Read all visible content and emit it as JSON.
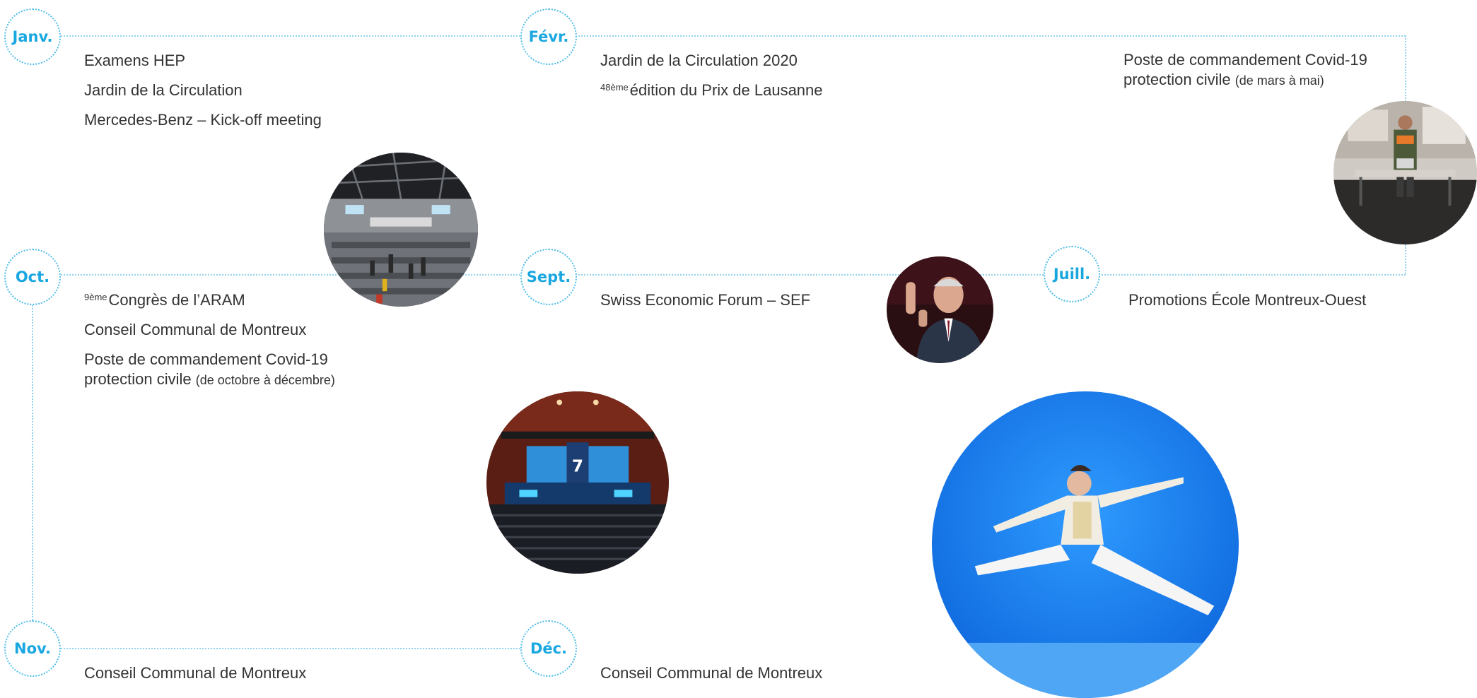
{
  "months": {
    "jan": "Janv.",
    "feb": "Févr.",
    "oct": "Oct.",
    "sep": "Sept.",
    "jul": "Juill.",
    "nov": "Nov.",
    "dec": "Déc."
  },
  "events": {
    "jan1": "Examens HEP",
    "jan2": "Jardin de la Circulation",
    "jan3": "Mercedes-Benz – Kick-off meeting",
    "feb1": "Jardin de la Circulation 2020",
    "feb2_sup": "48ème",
    "feb2_text": "édition du Prix de Lausanne",
    "mar1_line1": "Poste de commandement Covid-19",
    "mar1_line2": "protection civile",
    "mar1_note": "(de mars à mai)",
    "oct1_sup": "9ème",
    "oct1_text": "Congrès de l’ARAM",
    "oct2": "Conseil Communal de Montreux",
    "oct3_line1": "Poste de commandement Covid-19",
    "oct3_line2": "protection civile",
    "oct3_note": "(de octobre à décembre)",
    "sep1": "Swiss Economic Forum – SEF",
    "jul1": "Promotions École Montreux-Ouest",
    "nov1": "Conseil Communal de Montreux",
    "dec1": "Conseil Communal de Montreux"
  },
  "colors": {
    "accent": "#1aa7e0",
    "timeline": "#8fd2ee",
    "text": "#333333"
  }
}
